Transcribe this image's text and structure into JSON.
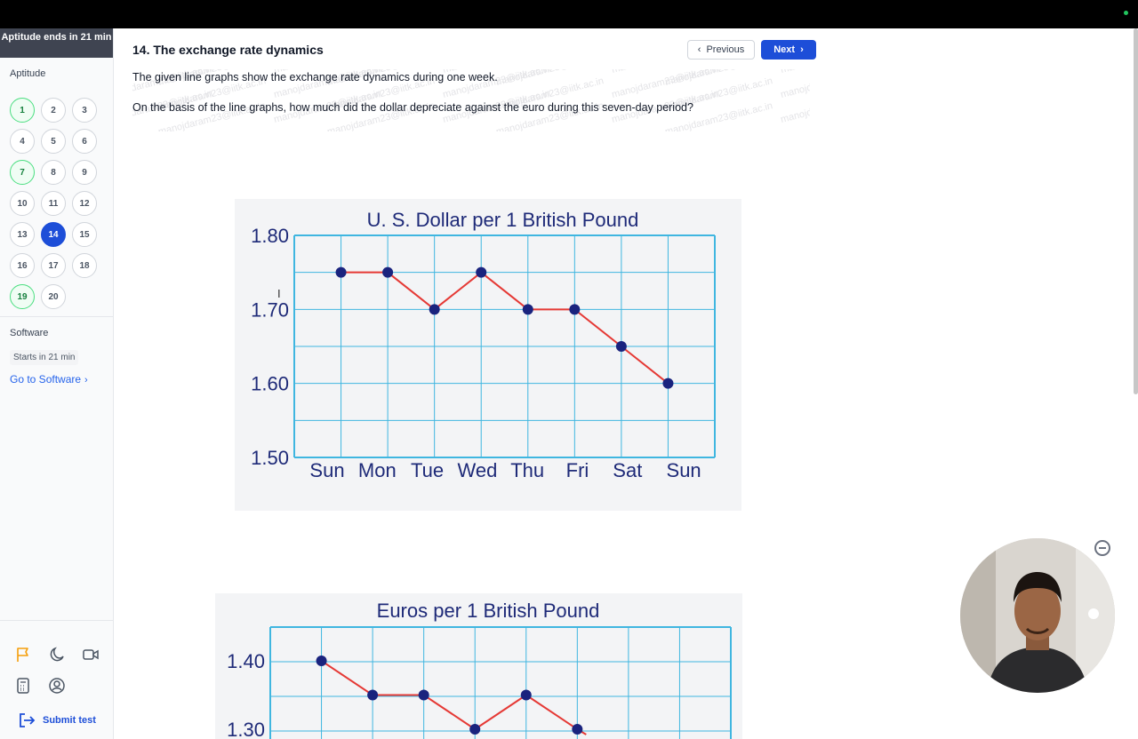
{
  "timer_text": "Aptitude ends in 21 min",
  "sections": {
    "aptitude_label": "Aptitude",
    "software_label": "Software",
    "software_status": "Starts in 21 min",
    "goto_software": "Go to Software"
  },
  "questions": [
    {
      "n": "1",
      "state": "answered"
    },
    {
      "n": "2",
      "state": "none"
    },
    {
      "n": "3",
      "state": "none"
    },
    {
      "n": "4",
      "state": "none"
    },
    {
      "n": "5",
      "state": "none"
    },
    {
      "n": "6",
      "state": "none"
    },
    {
      "n": "7",
      "state": "answered"
    },
    {
      "n": "8",
      "state": "none"
    },
    {
      "n": "9",
      "state": "none"
    },
    {
      "n": "10",
      "state": "none"
    },
    {
      "n": "11",
      "state": "none"
    },
    {
      "n": "12",
      "state": "none"
    },
    {
      "n": "13",
      "state": "none"
    },
    {
      "n": "14",
      "state": "current"
    },
    {
      "n": "15",
      "state": "none"
    },
    {
      "n": "16",
      "state": "none"
    },
    {
      "n": "17",
      "state": "none"
    },
    {
      "n": "18",
      "state": "none"
    },
    {
      "n": "19",
      "state": "answered"
    },
    {
      "n": "20",
      "state": "none"
    }
  ],
  "tools": [
    "flag-icon",
    "moon-icon",
    "video-icon",
    "calculator-icon",
    "user-circle-icon"
  ],
  "submit_label": "Submit test",
  "header": {
    "title": "14. The exchange rate dynamics",
    "prev_label": "Previous",
    "next_label": "Next"
  },
  "question": {
    "line1": "The given line graphs show the exchange rate dynamics during one week.",
    "line2": "On the basis of the line graphs, how much did the dollar depreciate against the euro during this seven-day period?",
    "watermark": "manojdaram23@iitk.ac.in"
  },
  "colors": {
    "accent": "#1d4ed8",
    "grid": "#3fb6e0",
    "line": "#e53935",
    "point": "#1a237e",
    "answered": "#4ade80"
  },
  "chart_data": [
    {
      "type": "line",
      "title": "U. S. Dollar per 1 British Pound",
      "categories": [
        "Sun",
        "Mon",
        "Tue",
        "Wed",
        "Thu",
        "Fri",
        "Sat",
        "Sun"
      ],
      "values": [
        1.75,
        1.75,
        1.7,
        1.75,
        1.7,
        1.7,
        1.65,
        1.6
      ],
      "ylim": [
        1.5,
        1.8
      ],
      "yticks": [
        "1.80",
        "1.70",
        "1.60",
        "1.50"
      ],
      "grid": true
    },
    {
      "type": "line",
      "title": "Euros per 1 British Pound",
      "values_visible": [
        1.4,
        1.35,
        1.35,
        1.3,
        1.35,
        1.3
      ],
      "yticks_visible": [
        "1.40",
        "1.30"
      ],
      "grid": true
    }
  ]
}
